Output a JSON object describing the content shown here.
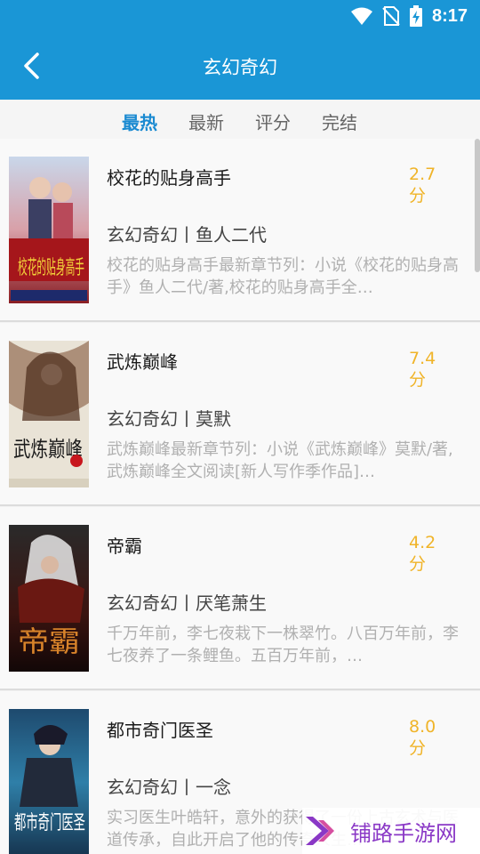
{
  "status": {
    "time": "8:17"
  },
  "header": {
    "title": "玄幻奇幻"
  },
  "tabs": [
    {
      "label": "最热",
      "active": true
    },
    {
      "label": "最新",
      "active": false
    },
    {
      "label": "评分",
      "active": false
    },
    {
      "label": "完结",
      "active": false
    }
  ],
  "books": [
    {
      "title": "校花的贴身高手",
      "score_value": "2.7",
      "score_unit": "分",
      "meta": "玄幻奇幻丨鱼人二代",
      "desc": "校花的贴身高手最新章节列：小说《校花的贴身高手》鱼人二代/著,校花的贴身高手全…",
      "cover_text": "校花的贴身高手"
    },
    {
      "title": "武炼巅峰",
      "score_value": "7.4",
      "score_unit": "分",
      "meta": "玄幻奇幻丨莫默",
      "desc": "武炼巅峰最新章节列：小说《武炼巅峰》莫默/著,武炼巅峰全文阅读[新人写作季作品]…",
      "cover_text": "武炼巅峰"
    },
    {
      "title": "帝霸",
      "score_value": "4.2",
      "score_unit": "分",
      "meta": "玄幻奇幻丨厌笔萧生",
      "desc": "千万年前，李七夜栽下一株翠竹。八百万年前，李七夜养了一条鲤鱼。五百万年前，…",
      "cover_text": "帝霸"
    },
    {
      "title": "都市奇门医圣",
      "score_value": "8.0",
      "score_unit": "分",
      "meta": "玄幻奇幻丨一念",
      "desc": "实习医生叶皓轩，意外的获得了一份上古玄术与医道传承，自此开启了他的传奇人生…",
      "cover_text": "都市奇门医圣"
    }
  ],
  "watermark": {
    "text": "铺路手游网"
  },
  "colors": {
    "primary": "#1a96d6",
    "accent_tab": "#1a8ad1",
    "score": "#f0b429"
  }
}
